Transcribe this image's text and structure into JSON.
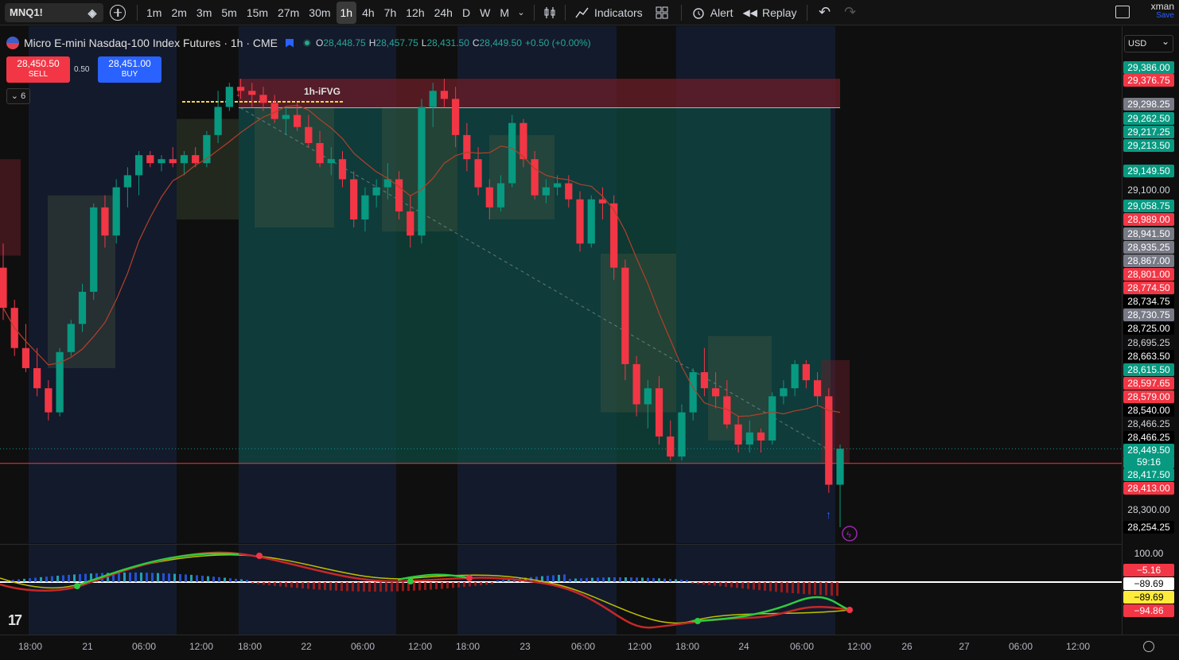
{
  "toolbar": {
    "symbol": "MNQ1!",
    "timeframes": [
      "1m",
      "2m",
      "3m",
      "5m",
      "15m",
      "27m",
      "30m",
      "1h",
      "4h",
      "7h",
      "12h",
      "24h",
      "D",
      "W",
      "M"
    ],
    "active_timeframe": "1h",
    "indicators_label": "Indicators",
    "alert_label": "Alert",
    "replay_label": "Replay",
    "user_name": "xman",
    "save_label": "Save"
  },
  "legend": {
    "title": "Micro E-mini Nasdaq-100 Index Futures · 1h · CME",
    "open_label": "O",
    "open": "28,448.75",
    "high_label": "H",
    "high": "28,457.75",
    "low_label": "L",
    "low": "28,431.50",
    "close_label": "C",
    "close": "28,449.50",
    "change": "+0.50 (+0.00%)"
  },
  "trade": {
    "sell_price": "28,450.50",
    "sell_label": "SELL",
    "buy_price": "28,451.00",
    "buy_label": "BUY",
    "spread": "0.50",
    "collapse_count": "6"
  },
  "currency": "USD",
  "fvg_label": "1h-iFVG",
  "price_labels": [
    {
      "text": "29,386.00",
      "bg": "#089981"
    },
    {
      "text": "29,376.75",
      "bg": "#f23645"
    },
    {
      "text": "29,298.25",
      "bg": "#787b86"
    },
    {
      "text": "29,262.50",
      "bg": "#089981"
    },
    {
      "text": "29,217.25",
      "bg": "#089981"
    },
    {
      "text": "29,213.50",
      "bg": "#089981"
    },
    {
      "text": "29,149.50",
      "bg": "#089981"
    },
    {
      "text": "29,100.00",
      "bg": ""
    },
    {
      "text": "29,058.75",
      "bg": "#089981"
    },
    {
      "text": "28,989.00",
      "bg": "#f23645"
    },
    {
      "text": "28,941.50",
      "bg": "#787b86"
    },
    {
      "text": "28,935.25",
      "bg": "#787b86"
    },
    {
      "text": "28,867.00",
      "bg": "#787b86"
    },
    {
      "text": "28,801.00",
      "bg": "#f23645"
    },
    {
      "text": "28,774.50",
      "bg": "#f23645"
    },
    {
      "text": "28,734.75",
      "bg": "#000000"
    },
    {
      "text": "28,730.75",
      "bg": "#787b86"
    },
    {
      "text": "28,725.00",
      "bg": "#000000"
    },
    {
      "text": "28,695.25",
      "bg": ""
    },
    {
      "text": "28,663.50",
      "bg": "#000000"
    },
    {
      "text": "28,615.50",
      "bg": "#089981"
    },
    {
      "text": "28,597.65",
      "bg": "#f23645"
    },
    {
      "text": "28,579.00",
      "bg": "#f23645"
    },
    {
      "text": "28,540.00",
      "bg": "#000000"
    },
    {
      "text": "28,466.25",
      "bg": ""
    },
    {
      "text": "28,466.25",
      "bg": "#000000"
    },
    {
      "text": "28,449.50",
      "bg": "#089981"
    },
    {
      "text": "59:16",
      "bg": "#089981"
    },
    {
      "text": "28,417.50",
      "bg": "#089981"
    },
    {
      "text": "28,413.00",
      "bg": "#f23645"
    },
    {
      "text": "28,300.00",
      "bg": ""
    },
    {
      "text": "28,254.25",
      "bg": "#000000"
    }
  ],
  "indicator_labels": [
    {
      "text": "100.00",
      "bg": "",
      "fg": "#d1d4dc"
    },
    {
      "text": "−5.16",
      "bg": "#f23645",
      "fg": "#ffffff"
    },
    {
      "text": "−89.69",
      "bg": "#ffffff",
      "fg": "#000000"
    },
    {
      "text": "−89.69",
      "bg": "#ffeb3b",
      "fg": "#000000"
    },
    {
      "text": "−94.86",
      "bg": "#f23645",
      "fg": "#ffffff"
    }
  ],
  "time_labels": [
    "18:00",
    "21",
    "06:00",
    "12:00",
    "18:00",
    "22",
    "06:00",
    "12:00",
    "18:00",
    "23",
    "06:00",
    "12:00",
    "18:00",
    "24",
    "06:00",
    "12:00",
    "26",
    "27",
    "06:00",
    "12:00"
  ],
  "colors": {
    "up": "#089981",
    "down": "#f23645",
    "ma_line": "#b2402a",
    "zone_red": "#6b1f2a",
    "zone_teal": "#0e4a42"
  },
  "chart_data": {
    "type": "candlestick",
    "title": "Micro E-mini Nasdaq-100 Index Futures · 1h · CME",
    "ylim": [
      28254.25,
      29386.0
    ],
    "candles": [
      [
        28900,
        28960,
        28770,
        28800
      ],
      [
        28800,
        28820,
        28680,
        28700
      ],
      [
        28700,
        28760,
        28640,
        28650
      ],
      [
        28650,
        28700,
        28580,
        28600
      ],
      [
        28600,
        28620,
        28520,
        28540
      ],
      [
        28540,
        28700,
        28530,
        28690
      ],
      [
        28690,
        28770,
        28680,
        28760
      ],
      [
        28760,
        28860,
        28740,
        28840
      ],
      [
        28840,
        29060,
        28820,
        29050
      ],
      [
        29050,
        29080,
        28950,
        28980
      ],
      [
        28980,
        29120,
        28960,
        29100
      ],
      [
        29100,
        29150,
        29050,
        29130
      ],
      [
        29130,
        29190,
        29080,
        29180
      ],
      [
        29180,
        29190,
        29150,
        29160
      ],
      [
        29160,
        29180,
        29140,
        29170
      ],
      [
        29170,
        29200,
        29150,
        29160
      ],
      [
        29160,
        29190,
        29130,
        29180
      ],
      [
        29180,
        29200,
        29150,
        29160
      ],
      [
        29160,
        29240,
        29150,
        29230
      ],
      [
        29230,
        29340,
        29210,
        29300
      ],
      [
        29300,
        29360,
        29290,
        29350
      ],
      [
        29350,
        29370,
        29320,
        29340
      ],
      [
        29340,
        29360,
        29300,
        29330
      ],
      [
        29330,
        29350,
        29290,
        29310
      ],
      [
        29310,
        29330,
        29260,
        29270
      ],
      [
        29270,
        29300,
        29230,
        29280
      ],
      [
        29280,
        29310,
        29240,
        29250
      ],
      [
        29250,
        29280,
        29200,
        29210
      ],
      [
        29210,
        29240,
        29150,
        29160
      ],
      [
        29160,
        29200,
        29130,
        29170
      ],
      [
        29170,
        29190,
        29100,
        29120
      ],
      [
        29120,
        29140,
        29000,
        29020
      ],
      [
        29020,
        29100,
        28990,
        29080
      ],
      [
        29080,
        29120,
        29050,
        29100
      ],
      [
        29100,
        29160,
        29070,
        29120
      ],
      [
        29120,
        29140,
        29020,
        29040
      ],
      [
        29040,
        29080,
        28950,
        28980
      ],
      [
        28980,
        29320,
        28960,
        29300
      ],
      [
        29300,
        29360,
        29250,
        29340
      ],
      [
        29340,
        29370,
        29300,
        29320
      ],
      [
        29320,
        29350,
        29200,
        29230
      ],
      [
        29230,
        29260,
        29140,
        29170
      ],
      [
        29170,
        29200,
        29080,
        29100
      ],
      [
        29100,
        29120,
        29020,
        29050
      ],
      [
        29050,
        29130,
        29040,
        29110
      ],
      [
        29110,
        29280,
        29100,
        29260
      ],
      [
        29260,
        29270,
        29150,
        29170
      ],
      [
        29170,
        29190,
        29070,
        29080
      ],
      [
        29080,
        29120,
        29060,
        29100
      ],
      [
        29100,
        29130,
        29080,
        29110
      ],
      [
        29110,
        29130,
        29050,
        29070
      ],
      [
        29070,
        29090,
        28940,
        28960
      ],
      [
        28960,
        29080,
        28950,
        29070
      ],
      [
        29070,
        29100,
        29020,
        29060
      ],
      [
        29060,
        29080,
        28870,
        28900
      ],
      [
        28900,
        28920,
        28620,
        28660
      ],
      [
        28660,
        28680,
        28530,
        28560
      ],
      [
        28560,
        28620,
        28500,
        28600
      ],
      [
        28600,
        28630,
        28460,
        28480
      ],
      [
        28480,
        28520,
        28420,
        28430
      ],
      [
        28430,
        28560,
        28420,
        28540
      ],
      [
        28540,
        28650,
        28520,
        28640
      ],
      [
        28640,
        28700,
        28580,
        28600
      ],
      [
        28600,
        28640,
        28550,
        28580
      ],
      [
        28580,
        28620,
        28500,
        28510
      ],
      [
        28510,
        28530,
        28440,
        28460
      ],
      [
        28460,
        28520,
        28440,
        28490
      ],
      [
        28490,
        28500,
        28440,
        28470
      ],
      [
        28470,
        28590,
        28460,
        28580
      ],
      [
        28580,
        28620,
        28560,
        28600
      ],
      [
        28600,
        28670,
        28580,
        28660
      ],
      [
        28660,
        28670,
        28600,
        28620
      ],
      [
        28620,
        28640,
        28560,
        28580
      ],
      [
        28580,
        28600,
        28340,
        28360
      ],
      [
        28360,
        28460,
        28254.25,
        28449.5
      ]
    ]
  }
}
